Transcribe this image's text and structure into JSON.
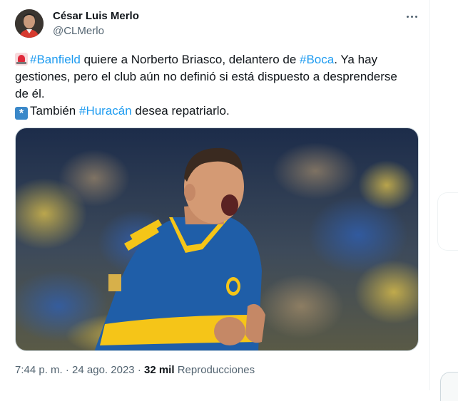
{
  "author": {
    "name": "César Luis Merlo",
    "handle": "@CLMerlo"
  },
  "tweet": {
    "line1_hashtag1": "#Banfield",
    "line1_text1": " quiere a Norberto Briasco, delantero de ",
    "line1_hashtag2": "#Boca",
    "line1_text2": ". Ya hay",
    "line2_text": "gestiones, pero el club aún no definió si está dispuesto a desprenderse",
    "line3_text": "de él.",
    "line4_text1": "También ",
    "line4_hashtag": "#Huracán",
    "line4_text2": " desea repatriarlo.",
    "emoji_1": "police-car-light-emoji",
    "emoji_2": "asterisk-emoji"
  },
  "meta": {
    "time": "7:44 p. m.",
    "separator": "·",
    "date": "24 ago. 2023",
    "views_count": "32 mil",
    "views_label": "Reproducciones"
  },
  "colors": {
    "link": "#1d9bf0",
    "secondary_text": "#536471",
    "primary_text": "#0f1419",
    "jersey_blue": "#1f5ea8",
    "jersey_yellow": "#f5c518"
  }
}
